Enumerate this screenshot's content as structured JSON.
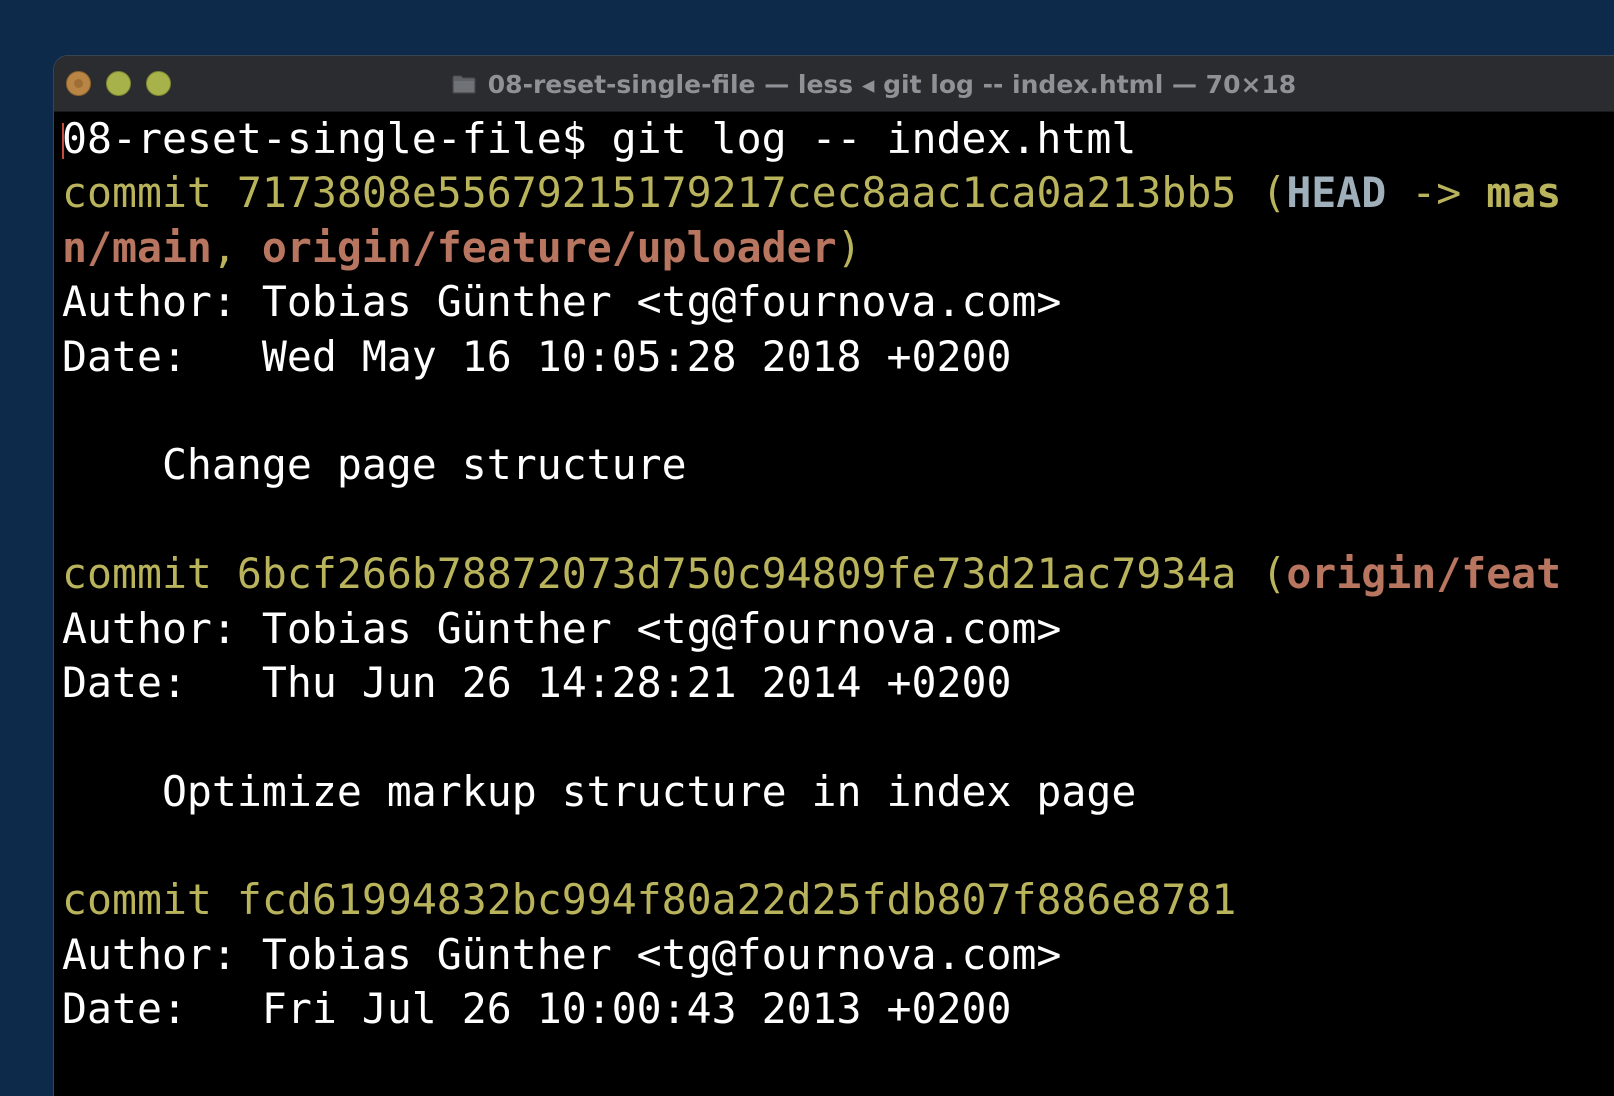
{
  "window": {
    "title": "08-reset-single-file — less ◂ git log -- index.html — 70×18"
  },
  "terminal": {
    "prompt": "08-reset-single-file$",
    "command": " git log -- index.html",
    "commits": [
      {
        "commit_label": "commit",
        "hash": "7173808e55679215179217cec8aac1ca0a213bb5",
        "refs_open": " (",
        "head": "HEAD",
        "arrow": " -> ",
        "branch": "mas",
        "refs_wrap_remote": "n/main",
        "refs_sep": ", ",
        "refs_remote2": "origin/feature/uploader",
        "refs_close": ")",
        "author_label": "Author:",
        "author": " Tobias Günther <tg@fournova.com>",
        "date_label": "Date:",
        "date": "   Wed May 16 10:05:28 2018 +0200",
        "message": "    Change page structure"
      },
      {
        "commit_label": "commit",
        "hash": "6bcf266b78872073d750c94809fe73d21ac7934a",
        "refs_open": " (",
        "refs_remote": "origin/feat",
        "author_label": "Author:",
        "author": " Tobias Günther <tg@fournova.com>",
        "date_label": "Date:",
        "date": "   Thu Jun 26 14:28:21 2014 +0200",
        "message": "    Optimize markup structure in index page"
      },
      {
        "commit_label": "commit",
        "hash": "fcd61994832bc994f80a22d25fdb807f886e8781",
        "author_label": "Author:",
        "author": " Tobias Günther <tg@fournova.com>",
        "date_label": "Date:",
        "date": "   Fri Jul 26 10:00:43 2013 +0200"
      }
    ]
  },
  "colors": {
    "desktop": "#0d2a4a",
    "terminal_bg": "#000000",
    "commit_yellow": "#b9b35c",
    "ref_remote": "#b8755f",
    "ref_head": "#9fb0bb",
    "text": "#ffffff"
  },
  "icons": {
    "close": "close-button",
    "minimize": "minimize-button",
    "zoom": "zoom-button",
    "title": "folder-icon"
  }
}
